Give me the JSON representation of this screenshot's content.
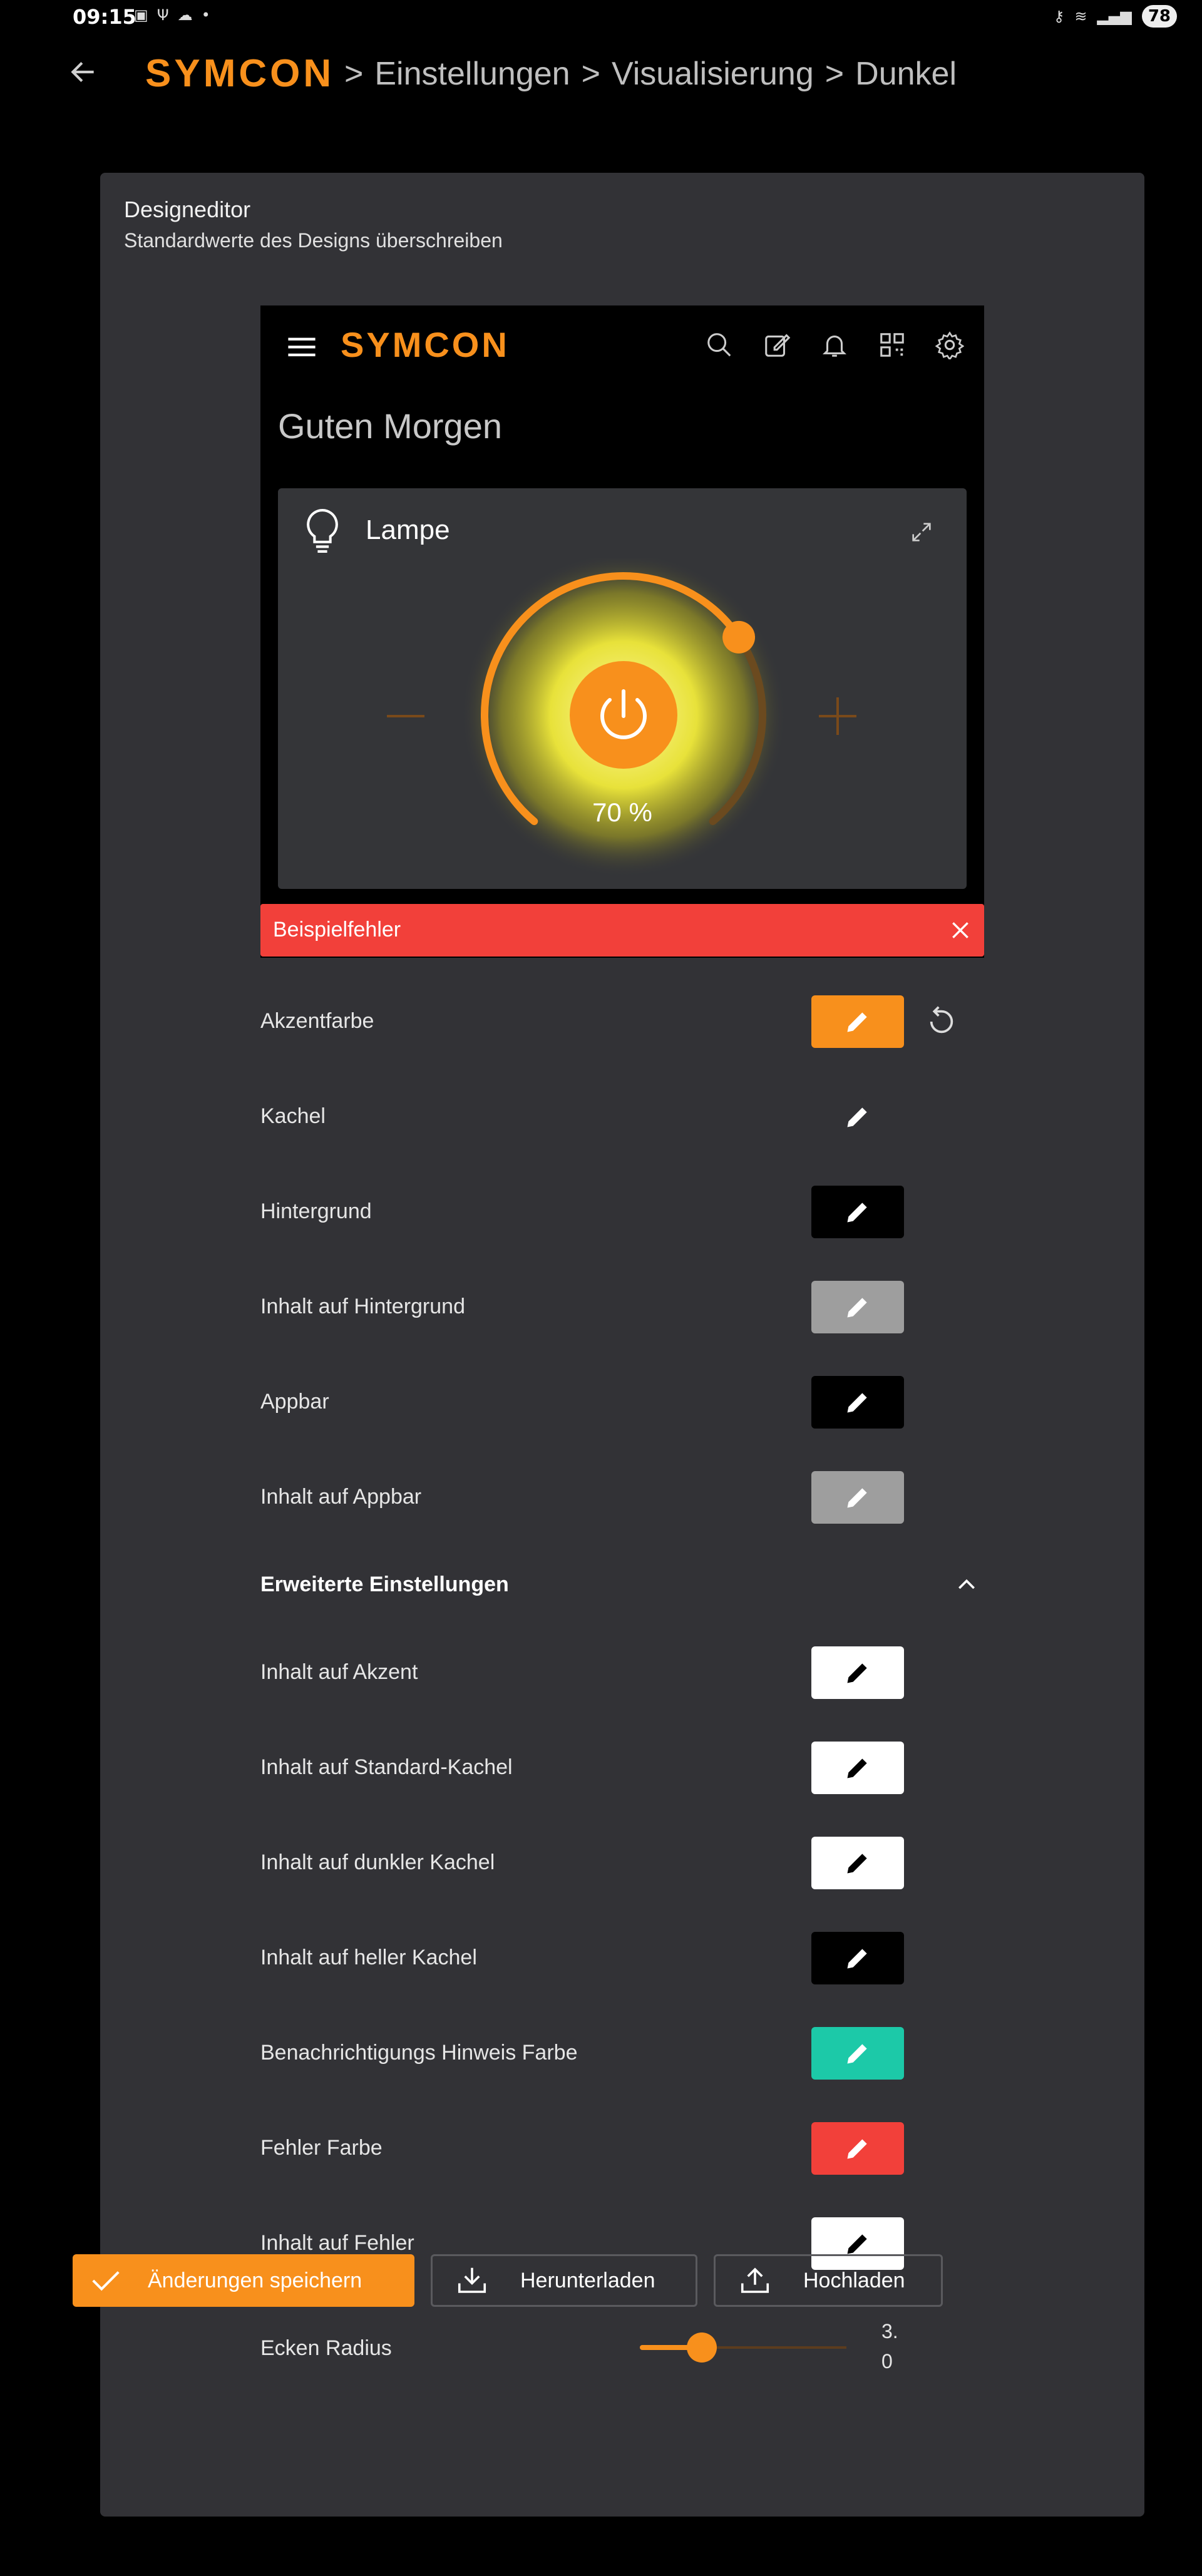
{
  "status_bar": {
    "time": "09:15",
    "battery": "78"
  },
  "header": {
    "logo": "SYMCON",
    "breadcrumb": [
      "Einstellungen",
      "Visualisierung",
      "Dunkel"
    ],
    "separator": ">"
  },
  "card": {
    "title": "Designeditor",
    "subtitle": "Standardwerte des Designs überschreiben"
  },
  "preview": {
    "logo": "SYMCON",
    "greeting": "Guten Morgen",
    "tile": {
      "name": "Lampe",
      "percent": "70 %",
      "level": 0.7
    },
    "error_text": "Beispielfehler"
  },
  "colors": {
    "accent": "#f8901c",
    "tile": "#323236",
    "background": "#000000",
    "content_on_background": "#9e9e9e",
    "appbar": "#000000",
    "content_on_appbar": "#9e9e9e",
    "content_on_accent": "#ffffff",
    "content_on_standard_tile": "#ffffff",
    "content_on_dark_tile": "#ffffff",
    "content_on_light_tile": "#000000",
    "notification": "#1cc9a8",
    "error": "#f2403a",
    "content_on_error": "#ffffff"
  },
  "settings": {
    "basic": [
      {
        "label": "Akzentfarbe",
        "color": "#f8901c",
        "icon_color": "#ffffff",
        "reset": true
      },
      {
        "label": "Kachel",
        "color": "#323236",
        "icon_color": "#ffffff",
        "reset": false
      },
      {
        "label": "Hintergrund",
        "color": "#000000",
        "icon_color": "#ffffff",
        "reset": false
      },
      {
        "label": "Inhalt auf Hintergrund",
        "color": "#9e9e9e",
        "icon_color": "#ffffff",
        "reset": false
      },
      {
        "label": "Appbar",
        "color": "#000000",
        "icon_color": "#ffffff",
        "reset": false
      },
      {
        "label": "Inhalt auf Appbar",
        "color": "#9e9e9e",
        "icon_color": "#ffffff",
        "reset": false
      }
    ],
    "advanced_label": "Erweiterte Einstellungen",
    "advanced": [
      {
        "label": "Inhalt auf Akzent",
        "color": "#ffffff",
        "icon_color": "#000000"
      },
      {
        "label": "Inhalt auf Standard-Kachel",
        "color": "#ffffff",
        "icon_color": "#000000"
      },
      {
        "label": "Inhalt auf dunkler Kachel",
        "color": "#ffffff",
        "icon_color": "#000000"
      },
      {
        "label": "Inhalt auf heller Kachel",
        "color": "#000000",
        "icon_color": "#ffffff"
      },
      {
        "label": "Benachrichtigungs Hinweis Farbe",
        "color": "#1cc9a8",
        "icon_color": "#ffffff"
      },
      {
        "label": "Fehler Farbe",
        "color": "#f2403a",
        "icon_color": "#ffffff"
      },
      {
        "label": "Inhalt auf Fehler",
        "color": "#ffffff",
        "icon_color": "#000000"
      }
    ],
    "corner_radius": {
      "label": "Ecken Radius",
      "value": "3.0",
      "fraction": 0.3
    }
  },
  "buttons": {
    "save": "Änderungen speichern",
    "download": "Herunterladen",
    "upload": "Hochladen"
  }
}
